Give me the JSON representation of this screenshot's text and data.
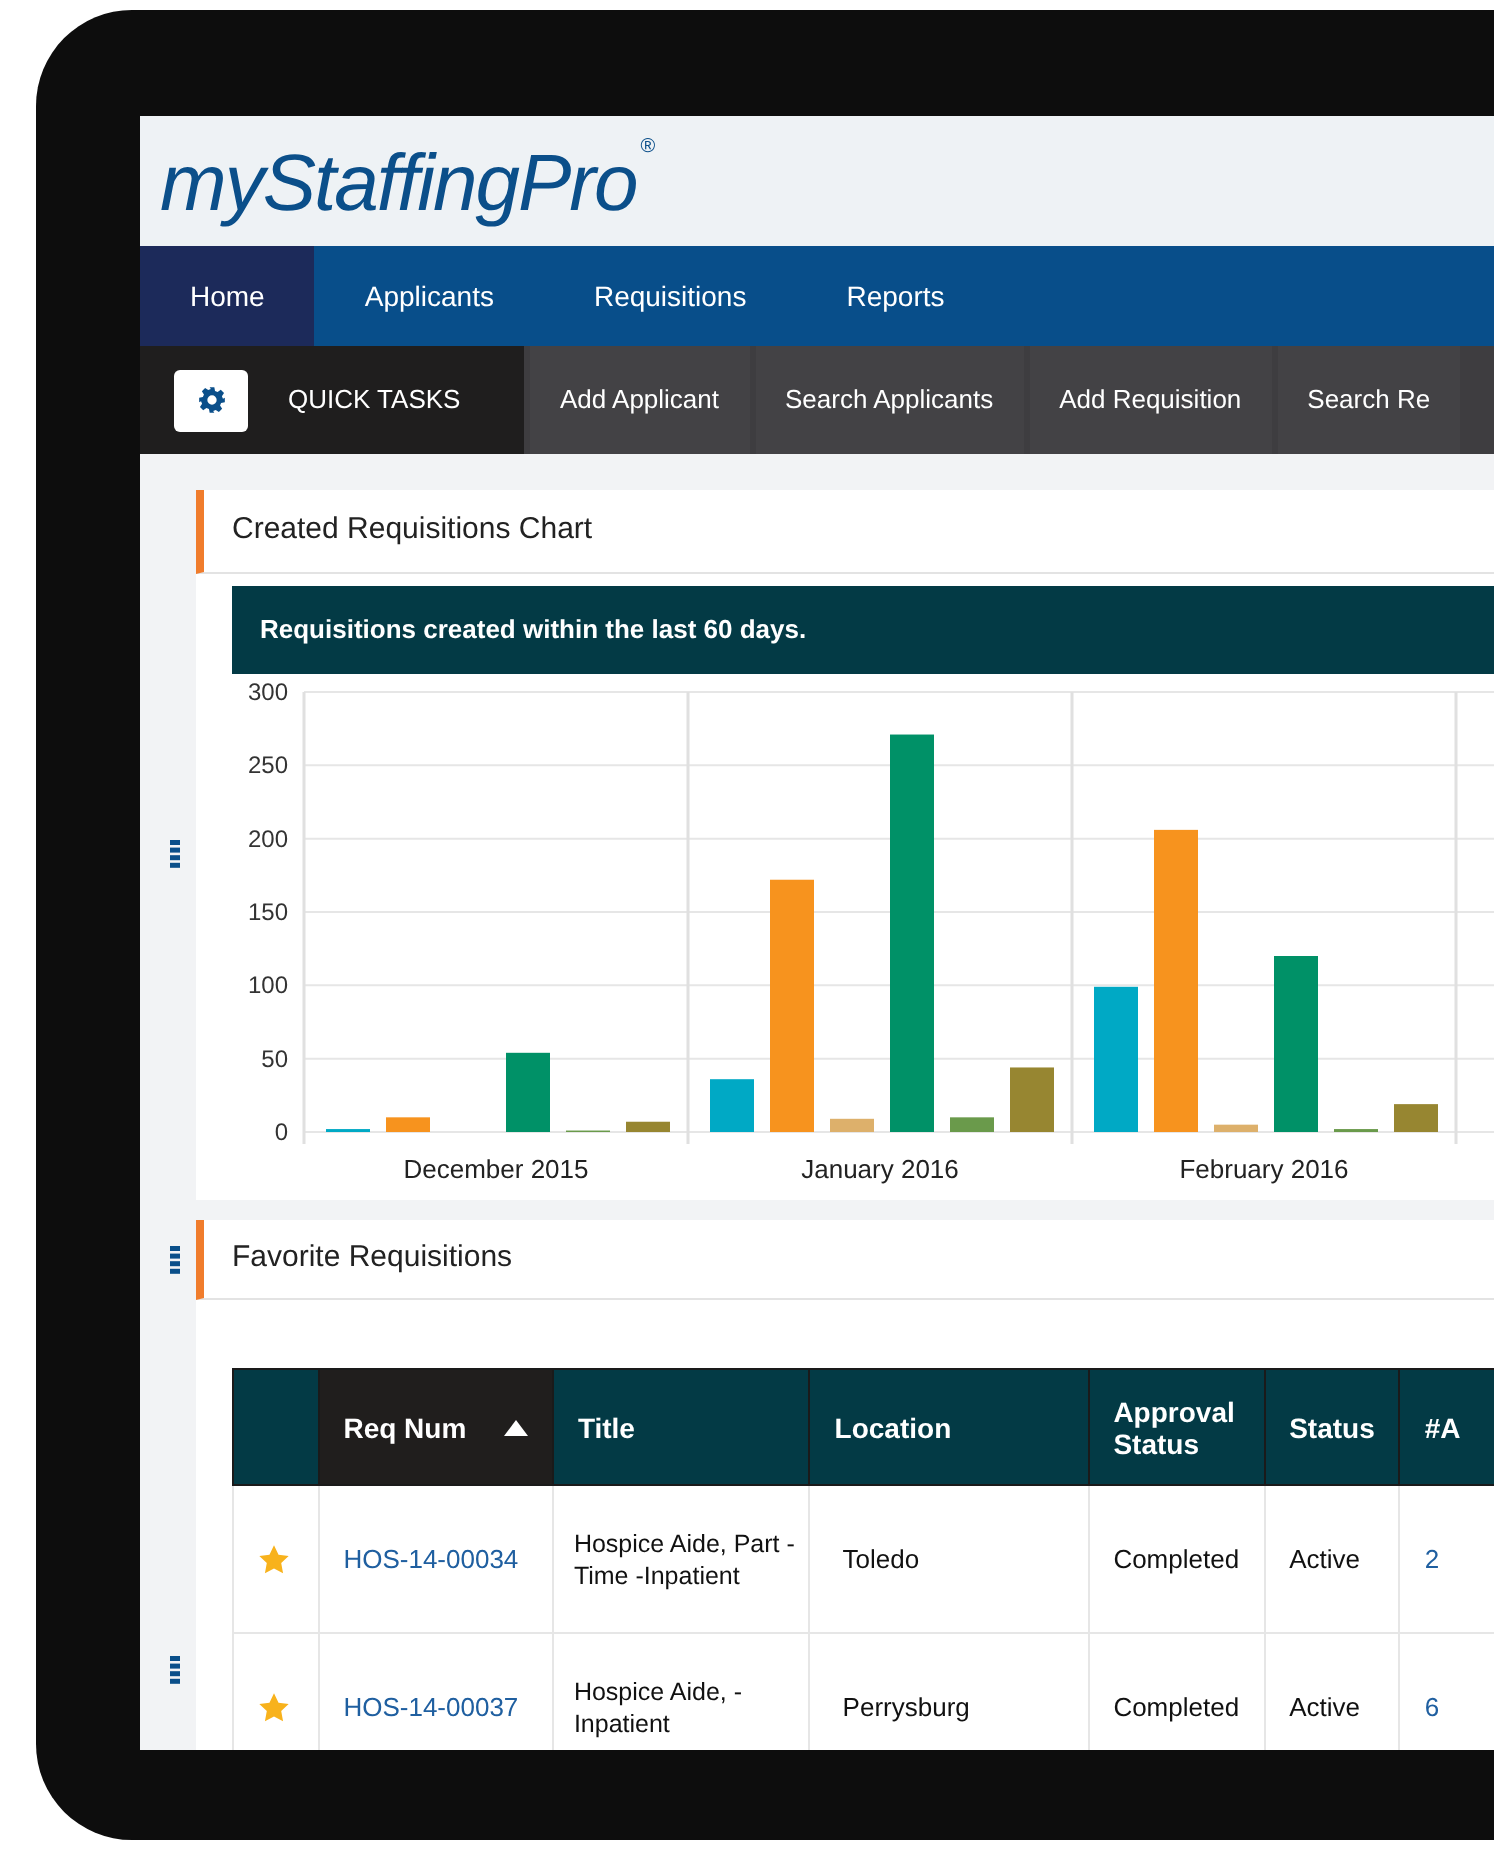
{
  "logo": {
    "text": "myStaffingPro",
    "mark": "®"
  },
  "nav": [
    {
      "label": "Home",
      "selected": true
    },
    {
      "label": "Applicants",
      "selected": false
    },
    {
      "label": "Requisitions",
      "selected": false
    },
    {
      "label": "Reports",
      "selected": false
    }
  ],
  "quick_tasks": {
    "label": "QUICK TASKS",
    "buttons": [
      "Add Applicant",
      "Search Applicants",
      "Add Requisition",
      "Search Re"
    ]
  },
  "chart_panel": {
    "title": "Created Requisitions Chart",
    "banner": "Requisitions created within the last 60 days.",
    "chart_data": {
      "type": "bar",
      "grid": true,
      "categories": [
        "December 2015",
        "January 2016",
        "February 2016"
      ],
      "ylim": [
        0,
        300
      ],
      "yticks": [
        0,
        50,
        100,
        150,
        200,
        250,
        300
      ],
      "series": [
        {
          "color": "#00a9c5",
          "values": [
            2,
            36,
            99
          ]
        },
        {
          "color": "#f7931e",
          "values": [
            10,
            172,
            206
          ]
        },
        {
          "color": "#ddb06b",
          "values": [
            0,
            9,
            5
          ]
        },
        {
          "color": "#009167",
          "values": [
            54,
            271,
            120
          ]
        },
        {
          "color": "#6a9a4b",
          "values": [
            1,
            10,
            2
          ]
        },
        {
          "color": "#978631",
          "values": [
            7,
            44,
            19
          ]
        }
      ]
    }
  },
  "favorites_panel": {
    "title": "Favorite Requisitions",
    "table": {
      "columns": [
        {
          "sorted": false
        },
        {
          "label": "Req Num",
          "sorted": true
        },
        {
          "label": "Title",
          "sorted": false
        },
        {
          "label": "Location",
          "sorted": false
        },
        {
          "label": "Approval Status",
          "sorted": false
        },
        {
          "label": "Status",
          "sorted": false
        },
        {
          "label": "#A",
          "sorted": false
        }
      ],
      "rows": [
        {
          "favorite": true,
          "req_num": "HOS-14-00034",
          "title": "Hospice Aide, Part -Time -Inpatient",
          "location": "Toledo",
          "approval_status": "Completed",
          "status": "Active",
          "column_7": "2"
        },
        {
          "favorite": true,
          "req_num": "HOS-14-00037",
          "title": "Hospice Aide, - Inpatient",
          "location": "Perrysburg",
          "approval_status": "Completed",
          "status": "Active",
          "column_7": "6"
        }
      ]
    }
  }
}
